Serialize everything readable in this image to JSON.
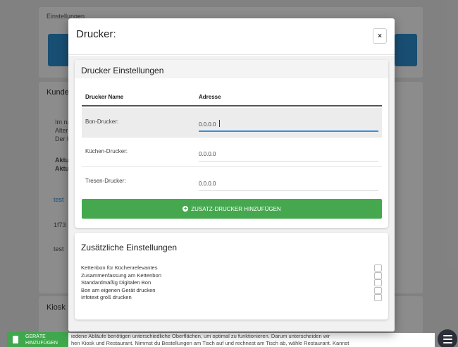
{
  "background": {
    "header_label": "Einstellungen",
    "section_kunde": "Kunde",
    "kunde_lines": [
      "Im na",
      "Alter",
      "Der K"
    ],
    "aktu_lines": [
      "Aktue",
      "Aktue"
    ],
    "test_tab": "test",
    "row_id": "1f73",
    "row_test": "test",
    "section_kiosk": "Kiosk",
    "add_device_button": "GERÄTE HINZUFÜGEN",
    "bottom_text": "iedene Abläufe benötigen unterschiedliche Oberflächen, um optimal zu funktionieren. Darum unterscheiden wir\nhen Kiosk und Restaurant. Nimmst du Bestellungen am Tisch auf und rechnest am Tisch ab, wähle Restaurant. Kannst"
  },
  "modal": {
    "title": "Drucker:",
    "close_label": "×",
    "printer_section": {
      "title": "Drucker Einstellungen",
      "columns": {
        "name": "Drucker Name",
        "address": "Adresse"
      },
      "rows": [
        {
          "label": "Bon-Drucker:",
          "value": "0.0.0.0"
        },
        {
          "label": "Küchen-Drucker:",
          "value": "0.0.0.0"
        },
        {
          "label": "Tresen-Drucker:",
          "value": "0.0.0.0"
        }
      ],
      "add_button": "ZUSATZ-DRUCKER HINZUFÜGEN"
    },
    "extra_section": {
      "title": "Zusätzliche Einstellungen",
      "options": [
        "Kettenbon für Küchenrelevantes",
        "Zusammenfassung am Kettenbon",
        "Standardmäßig Digitalen Bon",
        "Bon am eigenen Gerät drucken",
        "Infotext groß drucken"
      ]
    }
  },
  "colors": {
    "accent_green": "#45a84f",
    "input_focus_blue": "#3b8ed8",
    "background_blue": "#2f8fd2"
  }
}
